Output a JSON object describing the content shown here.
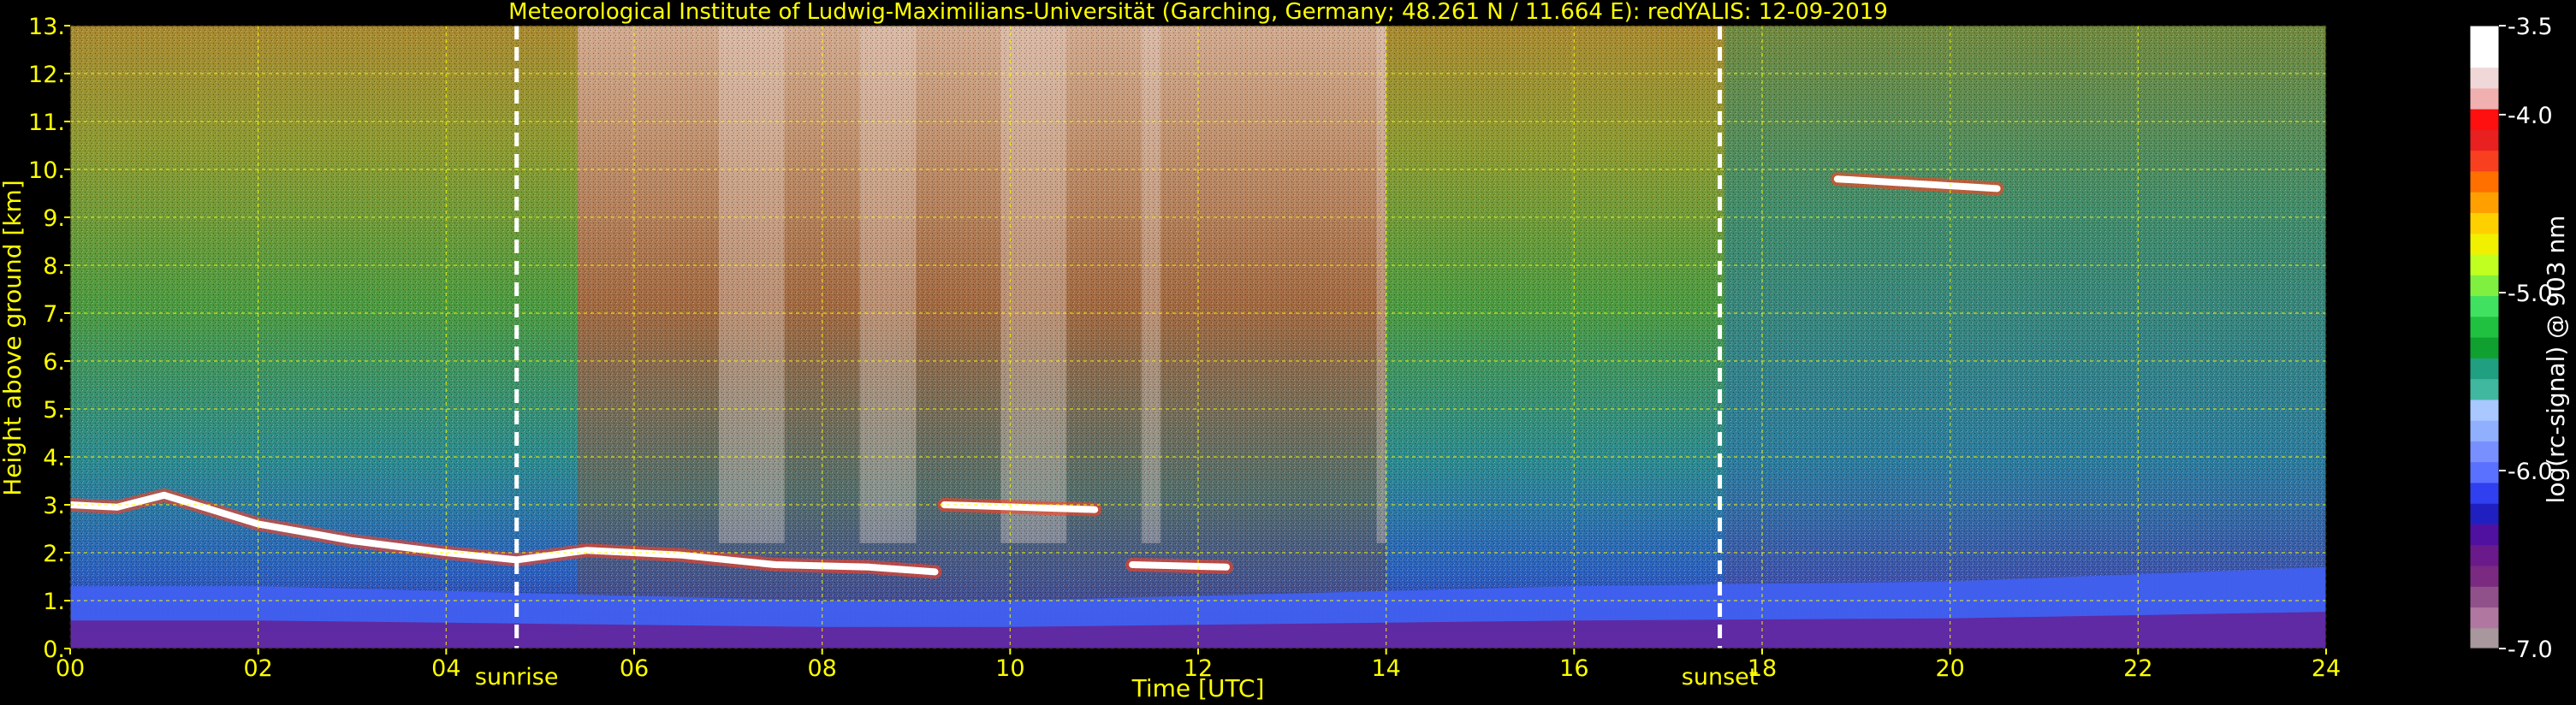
{
  "chart_data": {
    "type": "heatmap",
    "title": "Meteorological Institute of Ludwig-Maximilians-Universität (Garching, Germany; 48.261 N / 11.664 E):    redYALIS: 12-09-2019",
    "xlabel": "Time [UTC]",
    "ylabel": "Height above ground [km]",
    "xlim": [
      0,
      24
    ],
    "ylim": [
      0,
      13
    ],
    "x_ticks": [
      0,
      2,
      4,
      6,
      8,
      10,
      12,
      14,
      16,
      18,
      20,
      22,
      24
    ],
    "x_tick_labels": [
      "00",
      "02",
      "04",
      "06",
      "08",
      "10",
      "12",
      "14",
      "16",
      "18",
      "20",
      "22",
      "24"
    ],
    "y_ticks": [
      0,
      1,
      2,
      3,
      4,
      5,
      6,
      7,
      8,
      9,
      10,
      11,
      12,
      13
    ],
    "y_tick_labels": [
      "0.",
      "1.",
      "2.",
      "3.",
      "4.",
      "5.",
      "6.",
      "7.",
      "8.",
      "9.",
      "10.",
      "11.",
      "12.",
      "13."
    ],
    "grid": true,
    "events": [
      {
        "label": "sunrise",
        "time": 4.75
      },
      {
        "label": "sunset",
        "time": 17.55
      }
    ],
    "colorbar": {
      "label": "log(rc-signal) @ 903 nm",
      "range": [
        -7.0,
        -3.5
      ],
      "ticks": [
        -3.5,
        -4.0,
        -5.0,
        -6.0,
        -7.0
      ],
      "tick_labels": [
        "-3.5",
        "-4.0",
        "-5.0",
        "-6.0",
        "-7.0"
      ],
      "colors": [
        "#a8989e",
        "#b078a0",
        "#90508a",
        "#7a2a80",
        "#6a1a8a",
        "#5010a0",
        "#2020c0",
        "#3040f0",
        "#5a70ff",
        "#7890ff",
        "#90b0ff",
        "#a8c8ff",
        "#40b8a0",
        "#20a080",
        "#10a030",
        "#20c040",
        "#40e060",
        "#80f040",
        "#c0ff20",
        "#f0f000",
        "#ffd000",
        "#ffa000",
        "#ff7000",
        "#f84020",
        "#e82020",
        "#ff1010",
        "#f0b0b0",
        "#f0d8d8",
        "#ffffff",
        "#ffffff"
      ]
    },
    "features": [
      {
        "name": "cloud layer",
        "points": [
          [
            0,
            3.0
          ],
          [
            0.5,
            2.95
          ],
          [
            1.0,
            3.2
          ],
          [
            1.5,
            2.9
          ],
          [
            2.0,
            2.6
          ],
          [
            3.0,
            2.25
          ],
          [
            4.0,
            2.0
          ],
          [
            4.75,
            1.85
          ],
          [
            5.5,
            2.05
          ],
          [
            6.5,
            1.95
          ],
          [
            7.5,
            1.75
          ],
          [
            8.5,
            1.7
          ],
          [
            9.2,
            1.6
          ]
        ]
      },
      {
        "name": "cloud patch",
        "points": [
          [
            9.3,
            3.0
          ],
          [
            10.9,
            2.9
          ]
        ]
      },
      {
        "name": "cloud patch",
        "points": [
          [
            11.3,
            1.75
          ],
          [
            12.3,
            1.7
          ]
        ]
      },
      {
        "name": "cirrus",
        "points": [
          [
            18.8,
            9.8
          ],
          [
            20.5,
            9.6
          ]
        ]
      }
    ],
    "boundary_layer_top": [
      [
        0,
        1.3
      ],
      [
        2,
        1.3
      ],
      [
        4,
        1.2
      ],
      [
        6,
        1.1
      ],
      [
        8,
        1.0
      ],
      [
        10,
        1.0
      ],
      [
        12,
        1.1
      ],
      [
        14,
        1.2
      ],
      [
        16,
        1.3
      ],
      [
        18,
        1.35
      ],
      [
        20,
        1.4
      ],
      [
        22,
        1.55
      ],
      [
        24,
        1.7
      ]
    ]
  }
}
